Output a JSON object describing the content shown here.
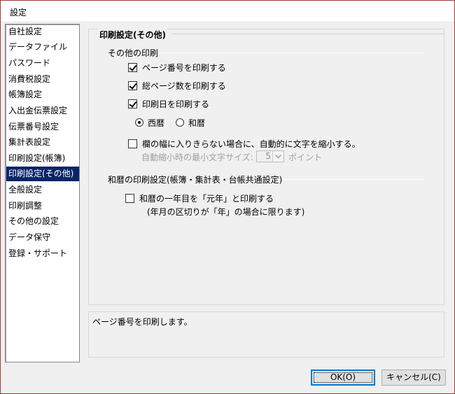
{
  "window": {
    "title": "設定"
  },
  "sidebar": {
    "items": [
      {
        "label": "自社設定",
        "selected": false
      },
      {
        "label": "データファイル",
        "selected": false
      },
      {
        "label": "パスワード",
        "selected": false
      },
      {
        "label": "消費税設定",
        "selected": false
      },
      {
        "label": "帳簿設定",
        "selected": false
      },
      {
        "label": "入出金伝票設定",
        "selected": false
      },
      {
        "label": "伝票番号設定",
        "selected": false
      },
      {
        "label": "集計表設定",
        "selected": false
      },
      {
        "label": "印刷設定(帳簿)",
        "selected": false
      },
      {
        "label": "印刷設定(その他)",
        "selected": true
      },
      {
        "label": "全般設定",
        "selected": false
      },
      {
        "label": "印刷調整",
        "selected": false
      },
      {
        "label": "その他の設定",
        "selected": false
      },
      {
        "label": "データ保守",
        "selected": false
      },
      {
        "label": "登録・サポート",
        "selected": false
      }
    ],
    "selected_bg": "#0a246a"
  },
  "panel": {
    "title": "印刷設定(その他)",
    "other_print": {
      "group_label": "その他の印刷",
      "page_number": {
        "label": "ページ番号を印刷する",
        "checked": true
      },
      "total_pages": {
        "label": "総ページ数を印刷する",
        "checked": true
      },
      "print_date": {
        "label": "印刷日を印刷する",
        "checked": true
      },
      "era_options": [
        {
          "label": "西暦",
          "selected": true
        },
        {
          "label": "和暦",
          "selected": false
        }
      ],
      "shrink": {
        "label": "欄の幅に入りきらない場合に、自動的に文字を縮小する。",
        "checked": false
      },
      "min_font": {
        "label": "自動縮小時の最小文字サイズ:",
        "value": "5",
        "unit": "ポイント",
        "enabled": false
      }
    },
    "japanese_era": {
      "group_label": "和暦の印刷設定(帳簿・集計表・台帳共通設定)",
      "first_year": {
        "label": "和暦の一年目を「元年」と印刷する",
        "checked": false
      },
      "note": "(年月の区切りが「年」の場合に限ります)"
    }
  },
  "description": "ページ番号を印刷します。",
  "buttons": {
    "ok": "OK(O)",
    "cancel": "キャンセル(C)"
  },
  "colors": {
    "window_border": "#9a3b3b",
    "default_button_border": "#0078d7"
  }
}
